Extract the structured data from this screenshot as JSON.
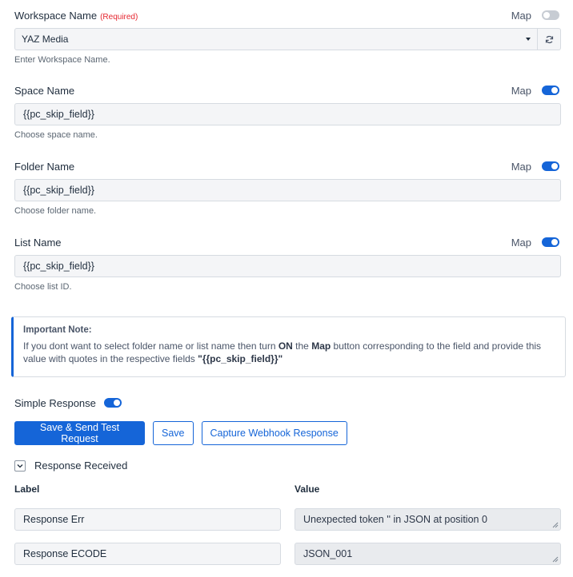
{
  "fields": {
    "workspace": {
      "label": "Workspace Name",
      "required_tag": "(Required)",
      "map_label": "Map",
      "map_on": false,
      "value": "YAZ Media",
      "helper": "Enter Workspace Name."
    },
    "space": {
      "label": "Space Name",
      "map_label": "Map",
      "map_on": true,
      "value": "{{pc_skip_field}}",
      "helper": "Choose space name."
    },
    "folder": {
      "label": "Folder Name",
      "map_label": "Map",
      "map_on": true,
      "value": "{{pc_skip_field}}",
      "helper": "Choose folder name."
    },
    "list": {
      "label": "List Name",
      "map_label": "Map",
      "map_on": true,
      "value": "{{pc_skip_field}}",
      "helper": "Choose list ID."
    }
  },
  "note": {
    "title": "Important Note:",
    "text_1": "If you dont want to select folder name or list name then turn ",
    "on_word": "ON",
    "text_2": " the ",
    "map_word": "Map",
    "text_3": " button corresponding to the field and provide this value with quotes in the respective fields ",
    "quoted": "\"{{pc_skip_field}}\""
  },
  "simple_response": {
    "label": "Simple Response",
    "on": true
  },
  "buttons": {
    "save_send": "Save & Send Test Request",
    "save": "Save",
    "capture": "Capture Webhook Response"
  },
  "response": {
    "toggle_label": "Response Received",
    "col_label": "Label",
    "col_value": "Value",
    "rows": [
      {
        "label": "Response Err",
        "value": "Unexpected token '' in JSON at position 0"
      },
      {
        "label": "Response ECODE",
        "value": "JSON_001"
      }
    ]
  },
  "colors": {
    "accent": "#1565d8",
    "required": "#e5262f",
    "toggle_off": "#c7ccd3"
  }
}
